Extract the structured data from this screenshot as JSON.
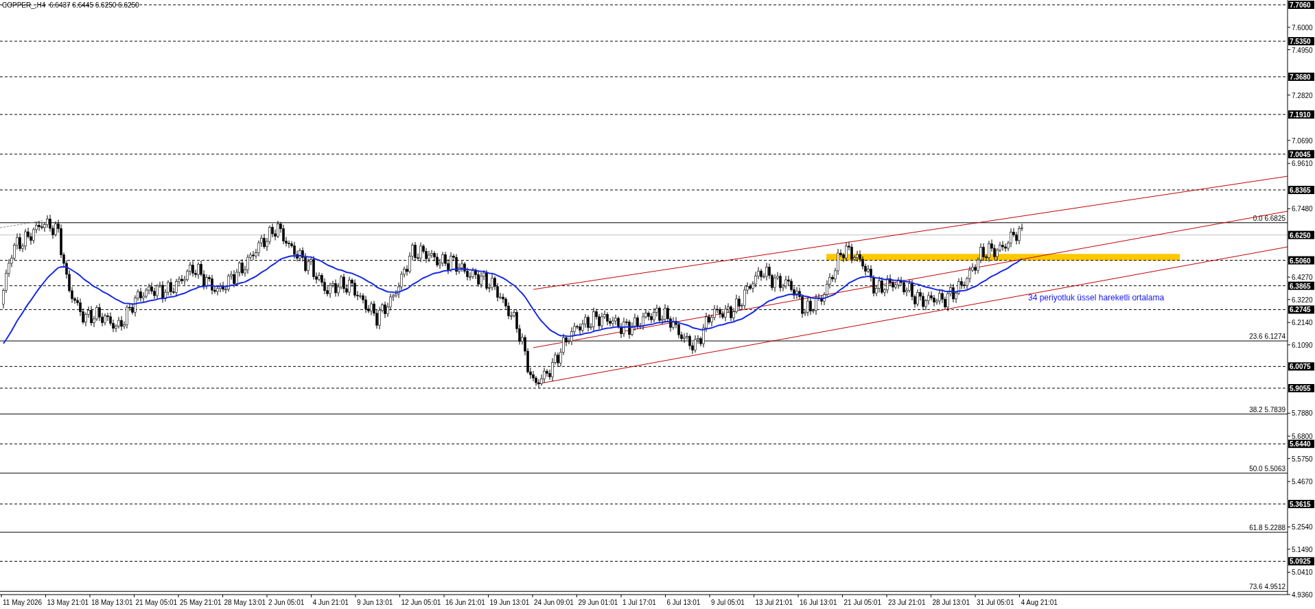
{
  "chart": {
    "title": "COPPER_,H4",
    "ohlc": "6.6437 6.6445 6.6250 6.6250",
    "levels": [
      {
        "kind": "dashed",
        "label": "7.7060"
      },
      {
        "kind": "dashed",
        "label": "7.5350"
      },
      {
        "kind": "dashed",
        "label": "7.3680"
      },
      {
        "kind": "dashed",
        "label": "7.1910"
      },
      {
        "kind": "dashed",
        "label": "7.0045"
      },
      {
        "kind": "dashed",
        "label": "6.8365"
      },
      {
        "kind": "current",
        "label": "6.6250"
      },
      {
        "kind": "dashed",
        "label": "6.5060"
      },
      {
        "kind": "dashed",
        "label": "6.3865"
      },
      {
        "kind": "dashed",
        "label": "6.2745"
      },
      {
        "kind": "dashed",
        "label": "6.0075"
      },
      {
        "kind": "dashed",
        "label": "5.9055"
      },
      {
        "kind": "dashed",
        "label": "5.6440"
      },
      {
        "kind": "dashed",
        "label": "5.3615"
      },
      {
        "kind": "dashed",
        "label": "5.0925"
      }
    ],
    "fib_levels": [
      {
        "label": "0.0 6.6825"
      },
      {
        "label": "23.6 6.1274"
      },
      {
        "label": "38.2 5.7839"
      },
      {
        "label": "50.0 5.5063"
      },
      {
        "label": "61.8 5.2288"
      },
      {
        "label": "73.6 4.9512"
      }
    ],
    "price_ticks": [
      "7.6000",
      "7.4950",
      "7.2820",
      "7.0690",
      "6.9610",
      "6.7480",
      "6.4270",
      "6.3220",
      "6.2140",
      "6.1090",
      "5.7880",
      "5.6800",
      "5.5750",
      "5.4670",
      "5.2540",
      "5.1490",
      "5.0410",
      "4.9360"
    ],
    "time_labels": [
      "11 May 2026",
      "13 May 21:01",
      "18 May 13:01",
      "21 May 05:01",
      "25 May 21:01",
      "28 May 13:01",
      "2 Jun 05:01",
      "4 Jun 21:01",
      "9 Jun 13:01",
      "12 Jun 05:01",
      "16 Jun 21:01",
      "19 Jun 13:01",
      "24 Jun 09:01",
      "29 Jun 01:01",
      "1 Jul 17:01",
      "6 Jul 13:01",
      "9 Jul 05:01",
      "13 Jul 21:01",
      "16 Jul 13:01",
      "21 Jul 05:01",
      "23 Jul 21:01",
      "28 Jul 13:01",
      "31 Jul 05:01",
      "4 Aug 21:01"
    ],
    "annotation": "34 periyotluk üssel hareketli ortalama"
  }
}
